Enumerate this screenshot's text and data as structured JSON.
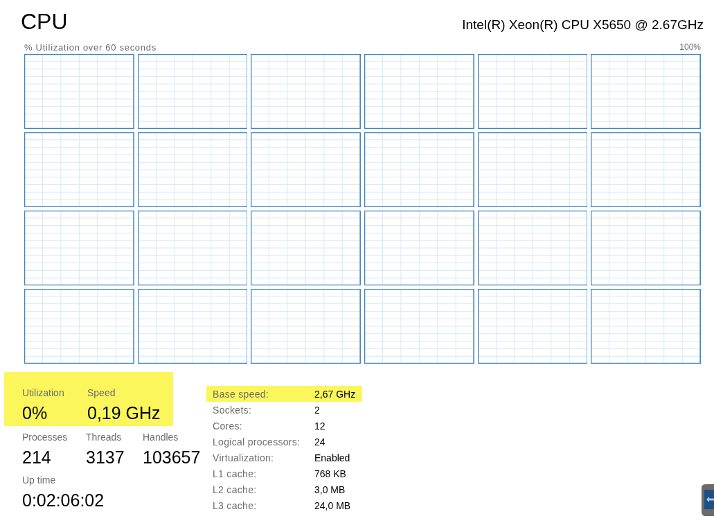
{
  "header": {
    "title": "CPU",
    "model": "Intel(R) Xeon(R) CPU X5650 @ 2.67GHz"
  },
  "graph_area": {
    "caption": "% Utilization over 60 seconds",
    "max_label": "100%",
    "graphs": [
      {
        "kind": "utilization"
      },
      {
        "kind": "utilization"
      },
      {
        "kind": "utilization"
      },
      {
        "kind": "utilization"
      },
      {
        "kind": "utilization"
      },
      {
        "kind": "utilization"
      },
      {
        "kind": "utilization"
      },
      {
        "kind": "utilization"
      },
      {
        "kind": "utilization"
      },
      {
        "kind": "utilization"
      },
      {
        "kind": "utilization"
      },
      {
        "kind": "utilization"
      },
      {
        "kind": "utilization"
      },
      {
        "kind": "utilization"
      },
      {
        "kind": "utilization"
      },
      {
        "kind": "utilization"
      },
      {
        "kind": "utilization"
      },
      {
        "kind": "utilization"
      },
      {
        "kind": "utilization"
      },
      {
        "kind": "utilization"
      },
      {
        "kind": "utilization"
      },
      {
        "kind": "utilization"
      },
      {
        "kind": "utilization"
      },
      {
        "kind": "utilization"
      }
    ]
  },
  "primary_stats": {
    "highlighted": true,
    "items": [
      {
        "label": "Utilization",
        "value": "0%"
      },
      {
        "label": "Speed",
        "value": "0,19 GHz"
      }
    ]
  },
  "counts": [
    {
      "label": "Processes",
      "value": "214"
    },
    {
      "label": "Threads",
      "value": "3137"
    },
    {
      "label": "Handles",
      "value": "103657"
    }
  ],
  "uptime": {
    "label": "Up time",
    "value": "0:02:06:02"
  },
  "details": [
    {
      "label": "Base speed:",
      "value": "2,67 GHz",
      "highlighted": true
    },
    {
      "label": "Sockets:",
      "value": "2",
      "highlighted": false
    },
    {
      "label": "Cores:",
      "value": "12",
      "highlighted": false
    },
    {
      "label": "Logical processors:",
      "value": "24",
      "highlighted": false
    },
    {
      "label": "Virtualization:",
      "value": "Enabled",
      "highlighted": false
    },
    {
      "label": "L1 cache:",
      "value": "768 KB",
      "highlighted": false
    },
    {
      "label": "L2 cache:",
      "value": "3,0 MB",
      "highlighted": false
    },
    {
      "label": "L3 cache:",
      "value": "24,0 MB",
      "highlighted": false
    }
  ]
}
